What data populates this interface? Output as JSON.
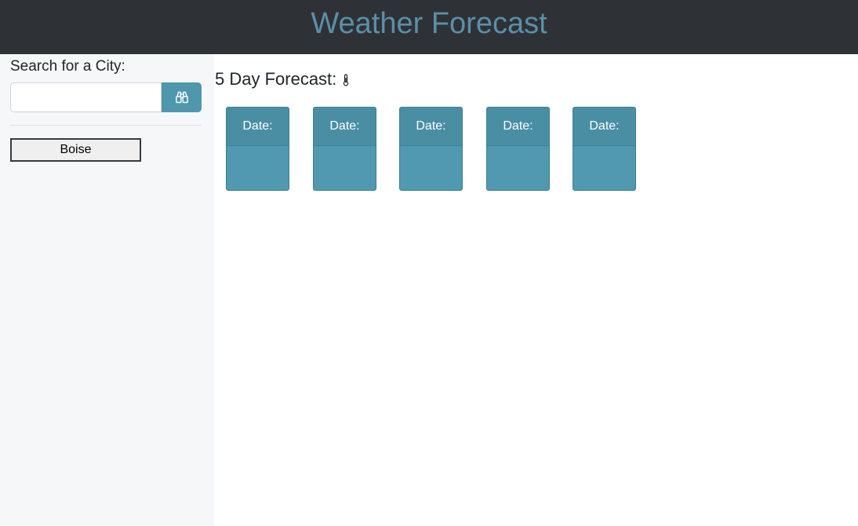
{
  "header": {
    "title": "Weather Forecast"
  },
  "sidebar": {
    "search_label": "Search for a City:",
    "search_input_value": "",
    "search_button_icon": "binoculars-icon",
    "history": [
      {
        "label": "Boise"
      }
    ]
  },
  "forecast": {
    "heading": "5 Day Forecast:",
    "heading_icon": "thermometer-icon",
    "cards": [
      {
        "date_label": "Date:"
      },
      {
        "date_label": "Date:"
      },
      {
        "date_label": "Date:"
      },
      {
        "date_label": "Date:"
      },
      {
        "date_label": "Date:"
      }
    ]
  },
  "colors": {
    "header_bg": "#2e3236",
    "title": "#5b8fa8",
    "accent": "#4f97ad",
    "card": "#5099b0",
    "sidebar_bg": "#f6f7f9"
  }
}
